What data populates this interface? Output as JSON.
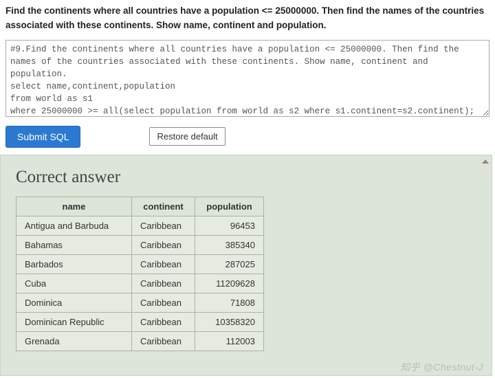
{
  "prompt": "Find the continents where all countries have a population <= 25000000. Then find the names of the countries associated with these continents. Show name, continent and population.",
  "sql_text": "#9.Find the continents where all countries have a population <= 25000000. Then find the names of the countries associated with these continents. Show name, continent and population.\nselect name,continent,population\nfrom world as s1\nwhere 25000000 >= all(select population from world as s2 where s1.continent=s2.continent);",
  "buttons": {
    "submit": "Submit SQL",
    "restore": "Restore default"
  },
  "result": {
    "title": "Correct answer",
    "columns": [
      "name",
      "continent",
      "population"
    ],
    "rows": [
      {
        "name": "Antigua and Barbuda",
        "continent": "Caribbean",
        "population": 96453
      },
      {
        "name": "Bahamas",
        "continent": "Caribbean",
        "population": 385340
      },
      {
        "name": "Barbados",
        "continent": "Caribbean",
        "population": 287025
      },
      {
        "name": "Cuba",
        "continent": "Caribbean",
        "population": 11209628
      },
      {
        "name": "Dominica",
        "continent": "Caribbean",
        "population": 71808
      },
      {
        "name": "Dominican Republic",
        "continent": "Caribbean",
        "population": 10358320
      },
      {
        "name": "Grenada",
        "continent": "Caribbean",
        "population": 112003
      }
    ]
  },
  "watermark": "知乎 @Chestnut-J"
}
